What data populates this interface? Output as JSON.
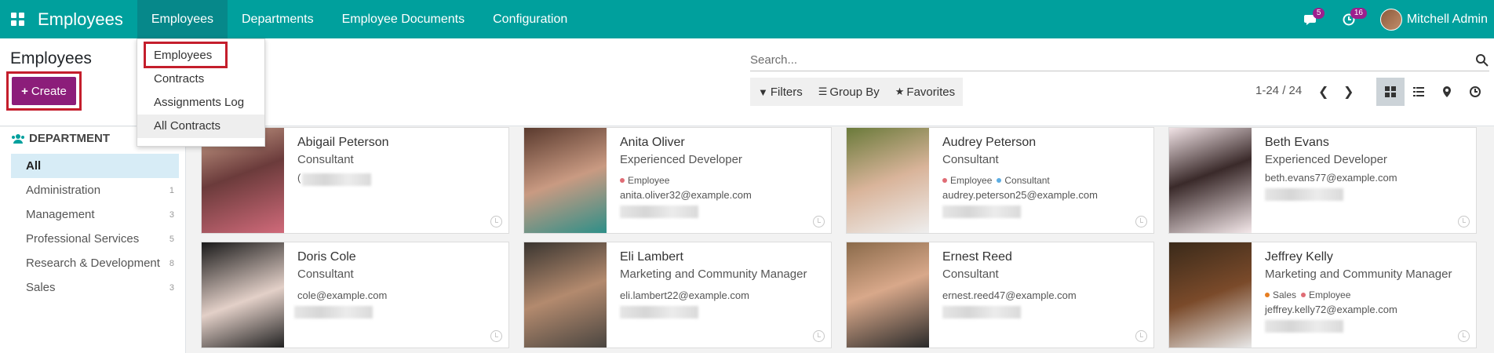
{
  "navbar": {
    "brand": "Employees",
    "menu": [
      "Employees",
      "Departments",
      "Employee Documents",
      "Configuration"
    ],
    "messages_badge": "5",
    "activity_badge": "16",
    "user_name": "Mitchell Admin"
  },
  "control_panel": {
    "breadcrumb": "Employees",
    "create_label": "Create",
    "search_placeholder": "Search...",
    "filters_label": "Filters",
    "group_by_label": "Group By",
    "favorites_label": "Favorites",
    "pager": "1-24 / 24"
  },
  "dropdown": {
    "items": [
      "Employees",
      "Contracts",
      "Assignments Log",
      "All Contracts"
    ]
  },
  "side_panel": {
    "header": "DEPARTMENT",
    "items": [
      {
        "label": "All",
        "count": ""
      },
      {
        "label": "Administration",
        "count": "1"
      },
      {
        "label": "Management",
        "count": "3"
      },
      {
        "label": "Professional Services",
        "count": "5"
      },
      {
        "label": "Research & Development",
        "count": "8"
      },
      {
        "label": "Sales",
        "count": "3"
      }
    ]
  },
  "employees": [
    {
      "name": "Abigail Peterson",
      "job": "Consultant",
      "tags": [],
      "email": "(",
      "photo_color": "#6b3b3b"
    },
    {
      "name": "Anita Oliver",
      "job": "Experienced Developer",
      "tags": [
        {
          "label": "Employee",
          "color": "#e06c75"
        }
      ],
      "email": "anita.oliver32@example.com",
      "photo_color": "#7a4a3a"
    },
    {
      "name": "Audrey Peterson",
      "job": "Consultant",
      "tags": [
        {
          "label": "Employee",
          "color": "#e06c75"
        },
        {
          "label": "Consultant",
          "color": "#5dade2"
        }
      ],
      "email": "audrey.peterson25@example.com",
      "photo_color": "#5a6b3a"
    },
    {
      "name": "Beth Evans",
      "job": "Experienced Developer",
      "tags": [],
      "email": "beth.evans77@example.com",
      "photo_color": "#e8d8dc"
    },
    {
      "name": "Doris Cole",
      "job": "Consultant",
      "tags": [],
      "email": "cole@example.com",
      "photo_color": "#2b2b2b"
    },
    {
      "name": "Eli Lambert",
      "job": "Marketing and Community Manager",
      "tags": [],
      "email": "eli.lambert22@example.com",
      "photo_color": "#5a4a3e"
    },
    {
      "name": "Ernest Reed",
      "job": "Consultant",
      "tags": [],
      "email": "ernest.reed47@example.com",
      "photo_color": "#6a5040"
    },
    {
      "name": "Jeffrey Kelly",
      "job": "Marketing and Community Manager",
      "tags": [
        {
          "label": "Sales",
          "color": "#e67e22"
        },
        {
          "label": "Employee",
          "color": "#e06c75"
        }
      ],
      "email": "jeffrey.kelly72@example.com",
      "photo_color": "#4a3020"
    }
  ]
}
